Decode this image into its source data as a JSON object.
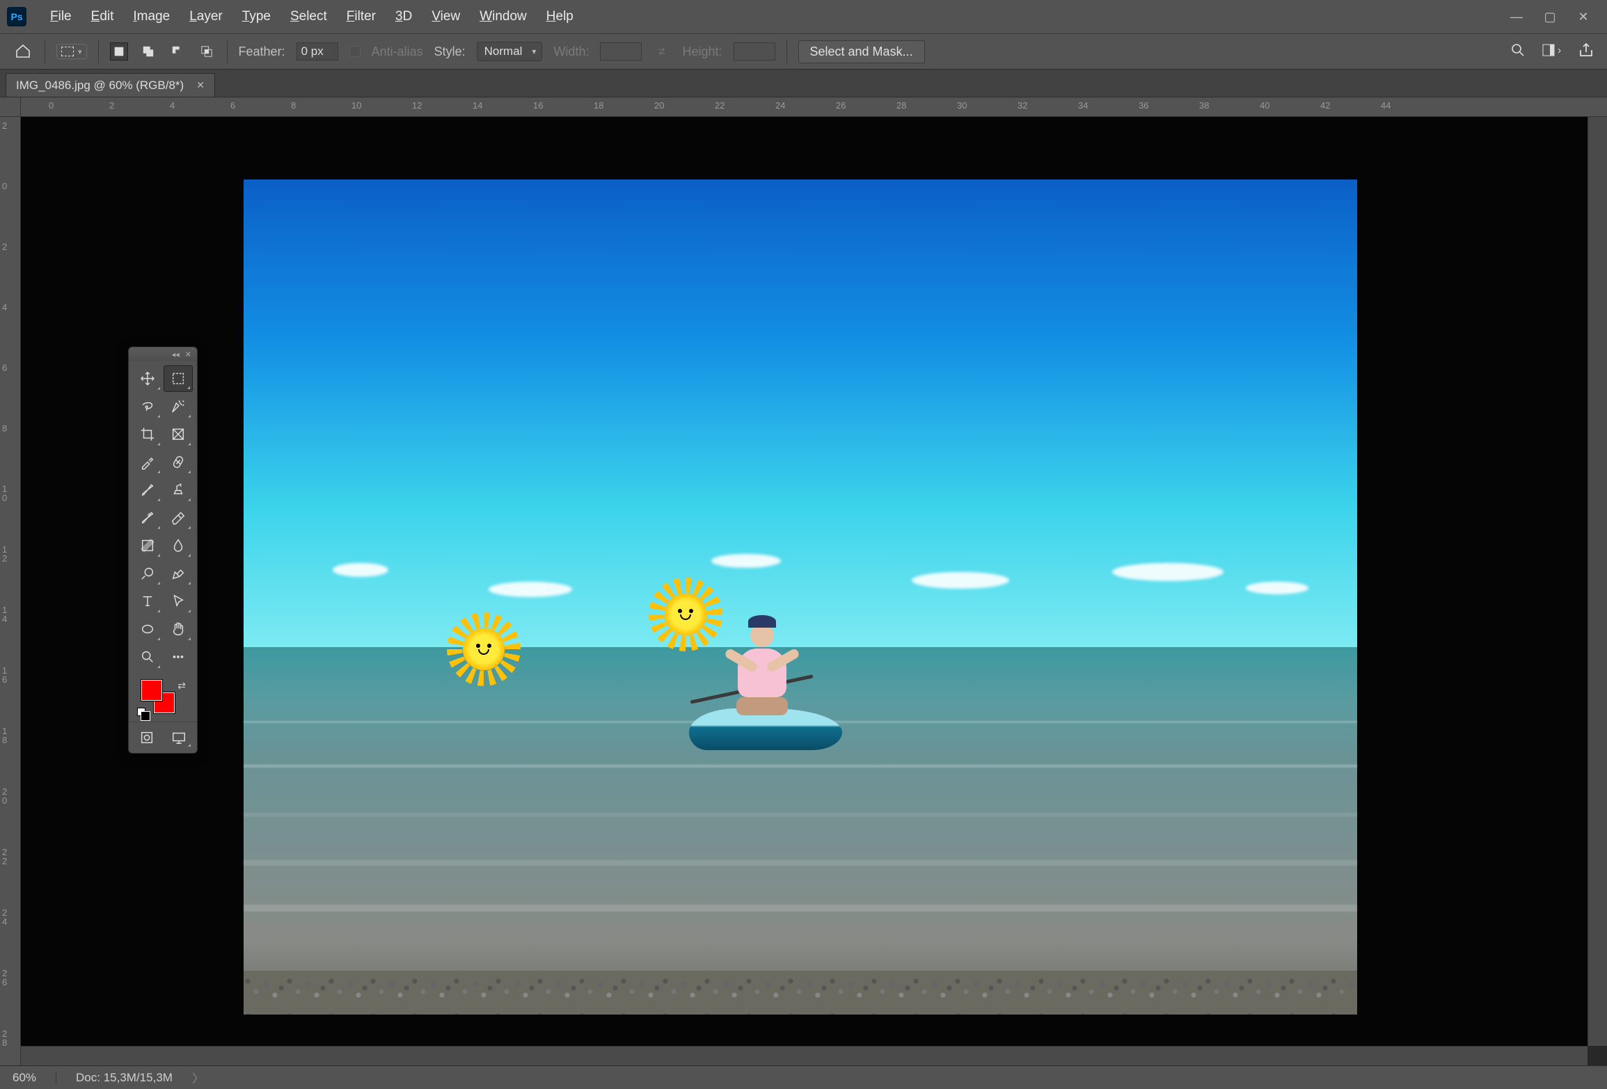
{
  "app": {
    "logo": "Ps"
  },
  "menu": {
    "file": {
      "label": "File",
      "ul": "F"
    },
    "edit": {
      "label": "Edit",
      "ul": "E"
    },
    "image": {
      "label": "Image",
      "ul": "I"
    },
    "layer": {
      "label": "Layer",
      "ul": "L"
    },
    "type": {
      "label": "Type",
      "ul": "T"
    },
    "select": {
      "label": "Select",
      "ul": "S"
    },
    "filter": {
      "label": "Filter",
      "ul": "F"
    },
    "threeD": {
      "label": "3D",
      "ul": "3"
    },
    "view": {
      "label": "View",
      "ul": "V"
    },
    "window": {
      "label": "Window",
      "ul": "W"
    },
    "help": {
      "label": "Help",
      "ul": "H"
    }
  },
  "options": {
    "feather_label": "Feather:",
    "feather_value": "0 px",
    "antialias_label": "Anti-alias",
    "style_label": "Style:",
    "style_value": "Normal",
    "width_label": "Width:",
    "width_value": "",
    "height_label": "Height:",
    "height_value": "",
    "select_mask_label": "Select and Mask..."
  },
  "tab": {
    "title": "IMG_0486.jpg @ 60% (RGB/8*)"
  },
  "rulers": {
    "h": [
      "0",
      "2",
      "4",
      "6",
      "8",
      "10",
      "12",
      "14",
      "16",
      "18",
      "20",
      "22",
      "24",
      "26",
      "28",
      "30",
      "32",
      "34",
      "36",
      "38",
      "40",
      "42",
      "44"
    ],
    "v": [
      "2",
      "0",
      "2",
      "4",
      "6",
      "8",
      "10",
      "12",
      "14",
      "16",
      "18",
      "20",
      "22",
      "24",
      "26",
      "28"
    ]
  },
  "tools": {
    "move": "move-tool",
    "marquee": "rectangular-marquee-tool",
    "lasso": "lasso-tool",
    "wand": "magic-wand-tool",
    "crop": "crop-tool",
    "frame": "frame-tool",
    "eyedrop": "eyedropper-tool",
    "heal": "spot-heal-tool",
    "brush": "brush-tool",
    "stamp": "clone-stamp-tool",
    "history": "history-brush-tool",
    "eraser": "eraser-tool",
    "gradient": "gradient-tool",
    "blur": "blur-tool",
    "dodge": "dodge-tool",
    "pen": "pen-tool",
    "text": "type-tool",
    "path": "path-select-tool",
    "shape": "shape-tool",
    "hand": "hand-tool",
    "zoom": "zoom-tool",
    "more": "edit-toolbar"
  },
  "colors": {
    "fg": "#ff0000",
    "bg": "#ff0000"
  },
  "status": {
    "zoom": "60%",
    "doc": "Doc: 15,3M/15,3M"
  }
}
